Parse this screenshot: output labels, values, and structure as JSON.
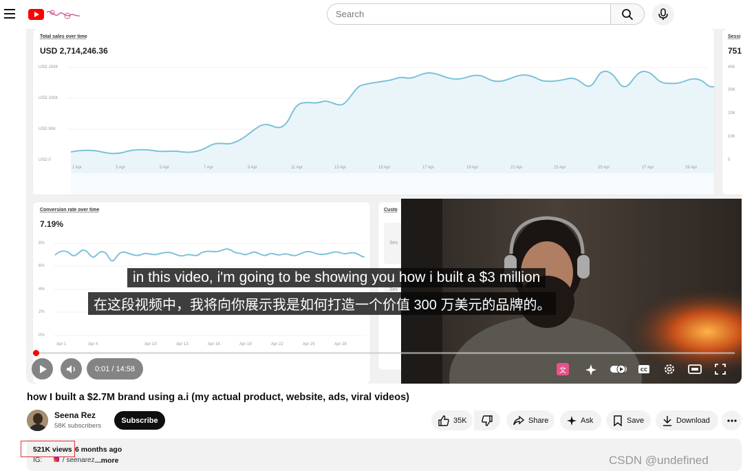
{
  "header": {
    "search_placeholder": "Search"
  },
  "dashboard": {
    "sales": {
      "title": "Total sales over time",
      "value": "USD 2,714,246.36",
      "y_ticks": [
        "USD 150K",
        "USD 100K",
        "USD 50K",
        "USD 0"
      ],
      "x_ticks": [
        "1 Apr",
        "3 Apr",
        "5 Apr",
        "7 Apr",
        "9 Apr",
        "11 Apr",
        "13 Apr",
        "15 Apr",
        "17 Apr",
        "19 Apr",
        "21 Apr",
        "23 Apr",
        "25 Apr",
        "27 Apr",
        "29 Apr"
      ]
    },
    "sessions": {
      "title": "Sessi",
      "value": "751",
      "y_ticks": [
        "40K",
        "30K",
        "20K",
        "10K",
        "0"
      ]
    },
    "conversion": {
      "title": "Conversion rate over time",
      "value": "7.19%",
      "y_ticks": [
        "8%",
        "6%",
        "4%",
        "2%",
        "0%"
      ],
      "x_ticks": [
        "Apr 1",
        "Apr 4",
        "Apr 10",
        "Apr 13",
        "Apr 16",
        "Apr 19",
        "Apr 22",
        "Apr 25",
        "Apr 28"
      ]
    },
    "customers": {
      "title": "Custo",
      "row_labels": [
        "Ses",
        "Ses"
      ]
    }
  },
  "player": {
    "subtitle_en": "in this video, i'm going to be showing you how i built a $3 million",
    "subtitle_zh": "在这段视频中，我将向你展示我是如何打造一个价值 300 万美元的品牌的。",
    "time": "0:01 / 14:58",
    "progress_fraction": 0.001,
    "accent_color": "#ff0000"
  },
  "video": {
    "title": "how I built a $2.7M brand using a.i (my actual product, website, ads, viral videos)",
    "channel_name": "Seena Rez",
    "subscribers": "58K subscribers",
    "subscribe_label": "Subscribe",
    "likes": "35K",
    "share_label": "Share",
    "ask_label": "Ask",
    "save_label": "Save",
    "download_label": "Download",
    "views": "521K views",
    "published": "6 months ago",
    "desc_prefix": "IG:",
    "desc_handle": "/ seenarez",
    "more_label": "...more"
  },
  "watermark": "CSDN @undefined"
}
